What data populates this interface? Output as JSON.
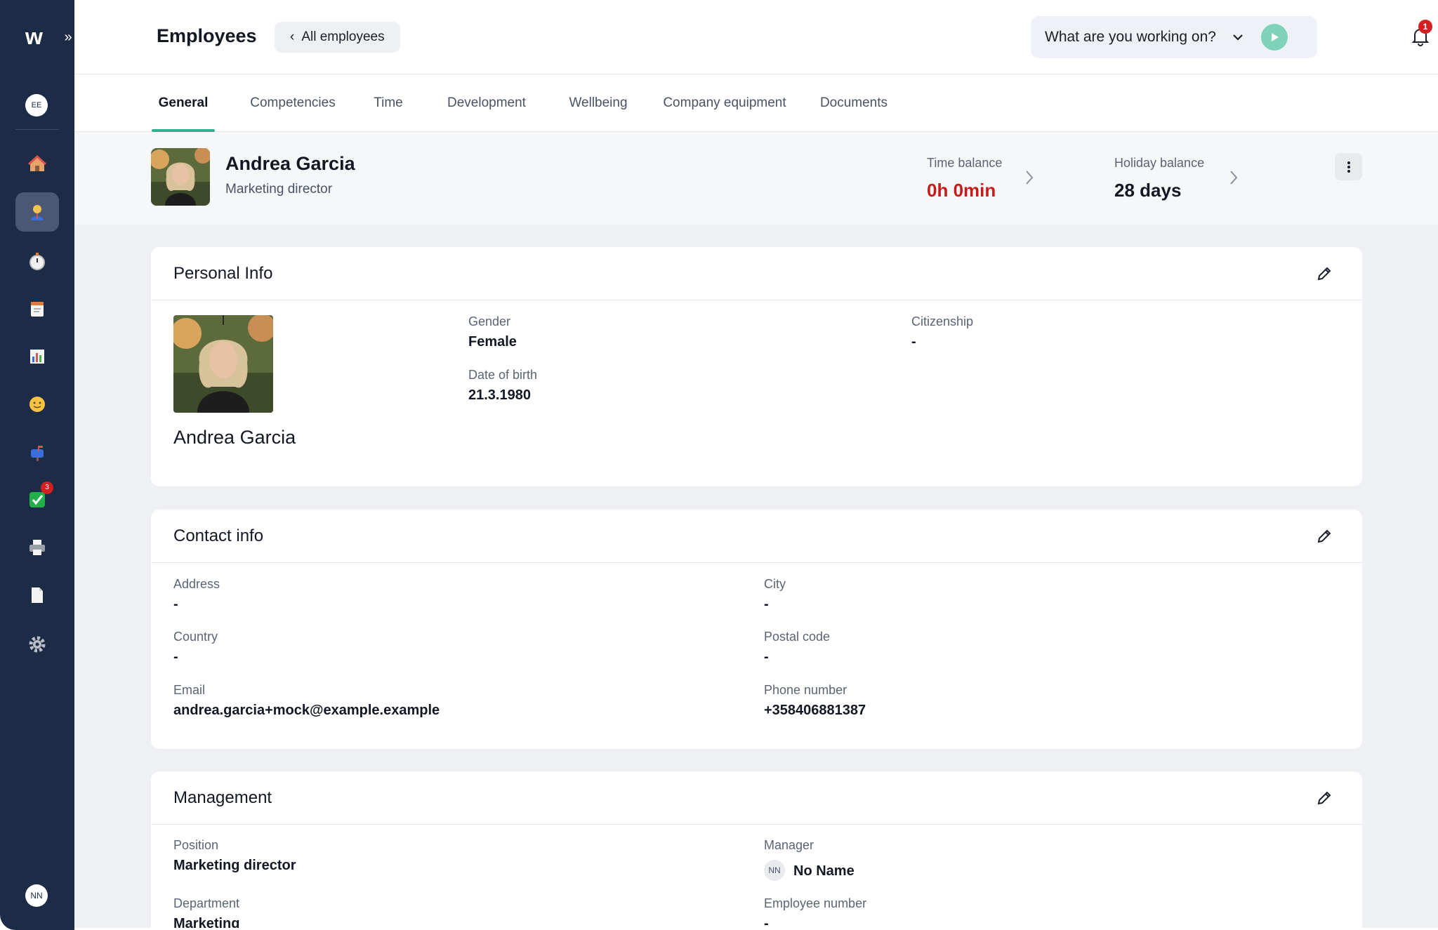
{
  "sidebar": {
    "logo": "w",
    "workspace_initials": "EE",
    "user_initials": "NN",
    "nav_items": [
      {
        "icon": "home-icon"
      },
      {
        "icon": "employee-icon"
      },
      {
        "icon": "stopwatch-icon"
      },
      {
        "icon": "notepad-icon"
      },
      {
        "icon": "chart-icon"
      },
      {
        "icon": "smiley-icon"
      },
      {
        "icon": "mailbox-icon"
      },
      {
        "icon": "checkbox-icon",
        "badge": "3"
      },
      {
        "icon": "printer-icon"
      },
      {
        "icon": "document-icon"
      },
      {
        "icon": "gear-icon"
      }
    ]
  },
  "header": {
    "title": "Employees",
    "back_label": "All employees",
    "working_prompt": "What are you working on?",
    "notification_count": "1"
  },
  "tabs": [
    "General",
    "Competencies",
    "Time",
    "Development",
    "Wellbeing",
    "Company equipment",
    "Documents"
  ],
  "active_tab": "General",
  "summary": {
    "name": "Andrea Garcia",
    "role": "Marketing director",
    "time_balance_label": "Time balance",
    "time_balance_value": "0h 0min",
    "holiday_balance_label": "Holiday balance",
    "holiday_balance_value": "28 days"
  },
  "personal_info": {
    "title": "Personal Info",
    "name": "Andrea Garcia",
    "gender_label": "Gender",
    "gender_value": "Female",
    "dob_label": "Date of birth",
    "dob_value": "21.3.1980",
    "citizenship_label": "Citizenship",
    "citizenship_value": "-"
  },
  "contact_info": {
    "title": "Contact info",
    "address_label": "Address",
    "address_value": "-",
    "city_label": "City",
    "city_value": "-",
    "country_label": "Country",
    "country_value": "-",
    "postal_label": "Postal code",
    "postal_value": "-",
    "email_label": "Email",
    "email_value": "andrea.garcia+mock@example.example",
    "phone_label": "Phone number",
    "phone_value": "+358406881387"
  },
  "management": {
    "title": "Management",
    "position_label": "Position",
    "position_value": "Marketing director",
    "manager_label": "Manager",
    "manager_initials": "NN",
    "manager_value": "No Name",
    "department_label": "Department",
    "department_value": "Marketing",
    "employee_number_label": "Employee number",
    "employee_number_value": "-"
  },
  "colors": {
    "sidebar": "#1c2b46",
    "accent": "#2fb38f",
    "negative": "#c71a1a",
    "play": "#7ed3b8"
  }
}
